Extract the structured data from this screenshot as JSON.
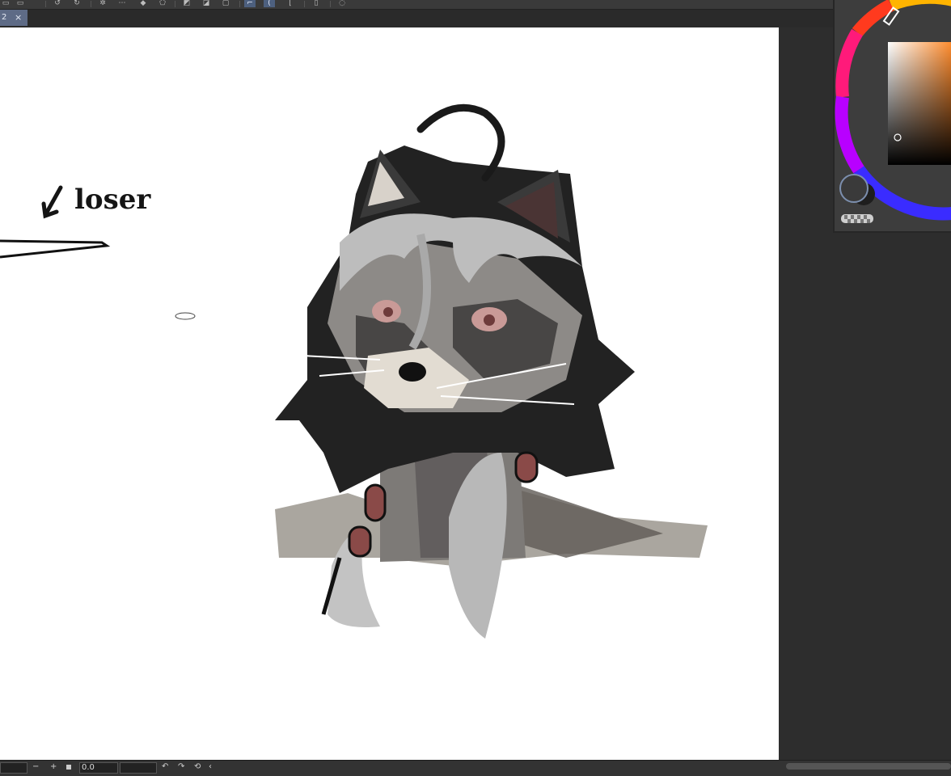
{
  "toolbar": {
    "icons": [
      "lasso-icon",
      "loading-spinner-icon",
      "fill-icon",
      "transform-icon",
      "select-icon",
      "pen-icon",
      "ruler-icon",
      "device-icon",
      "speech-icon"
    ]
  },
  "document_tab": {
    "number": "2",
    "close": "×"
  },
  "canvas": {
    "annotation_text": "loser"
  },
  "color_panel": {
    "main_color": "#3a3a3a",
    "sub_color": "#1e1e1e",
    "hue_marker_color": "#ff9a2a"
  },
  "statusbar": {
    "zoom_out": "−",
    "zoom_in": "+",
    "rotation_value": "0.0",
    "rotate_left": "↶",
    "rotate_right": "↷",
    "reset": "⟲",
    "collapse": "‹"
  }
}
